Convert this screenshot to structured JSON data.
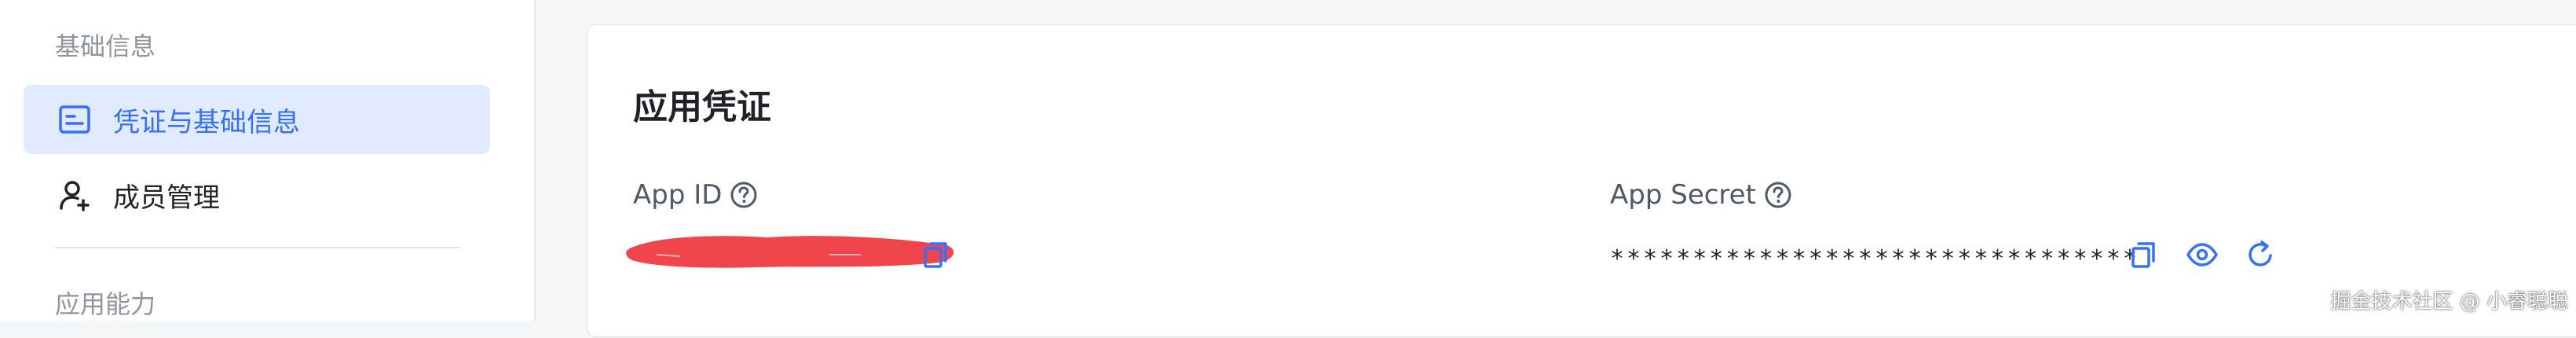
{
  "sidebar": {
    "group1_title": "基础信息",
    "items": [
      {
        "label": "凭证与基础信息",
        "icon": "id-card-icon",
        "active": true
      },
      {
        "label": "成员管理",
        "icon": "add-user-icon",
        "active": false
      }
    ],
    "group2_title": "应用能力"
  },
  "main": {
    "title": "应用凭证",
    "app_id": {
      "label": "App ID",
      "help_icon": "help-circle-icon",
      "value_redacted": true,
      "copy_icon": "copy-icon"
    },
    "app_secret": {
      "label": "App Secret",
      "help_icon": "help-circle-icon",
      "value": "********************************",
      "copy_icon": "copy-icon",
      "show_icon": "eye-icon",
      "reset_icon": "refresh-icon"
    }
  },
  "watermark": "掘金技术社区 @ 小睿聪聪",
  "colors": {
    "accent": "#3370ff",
    "active_bg": "#e1eaff",
    "redaction": "#f0454a"
  }
}
